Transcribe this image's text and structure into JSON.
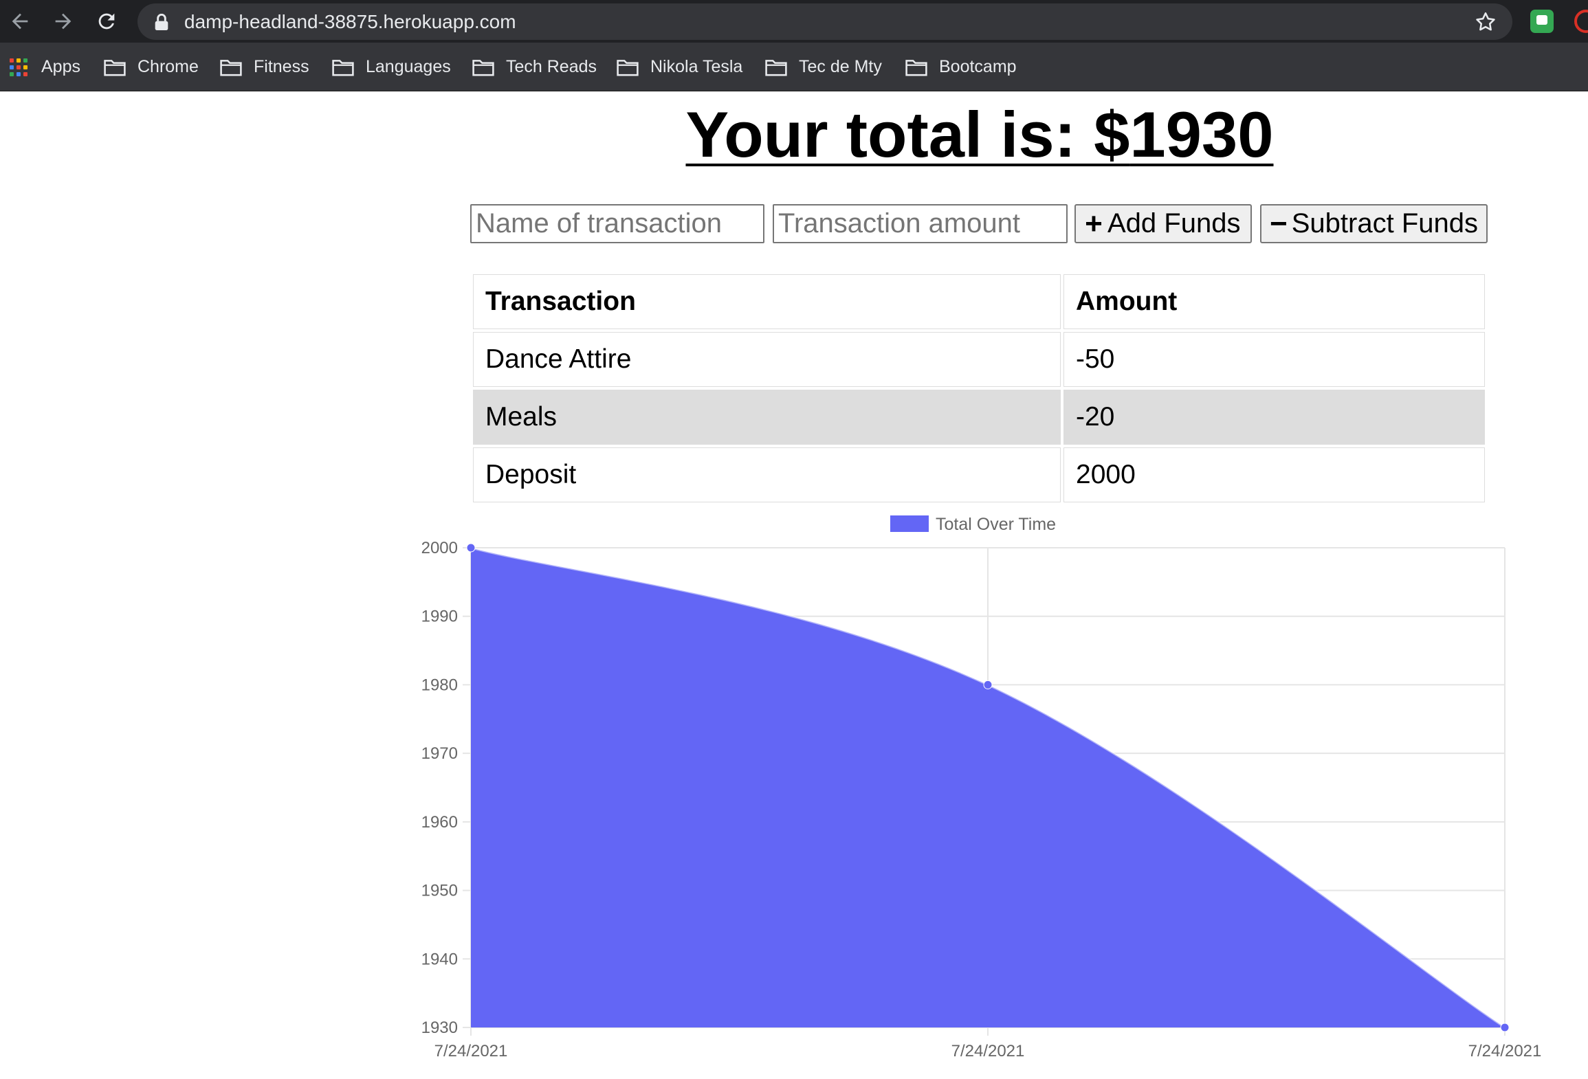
{
  "browser": {
    "url": "damp-headland-38875.herokuapp.com",
    "bookmarks": [
      {
        "label": "Apps",
        "icon": "apps-grid-icon"
      },
      {
        "label": "Chrome",
        "icon": "folder-icon"
      },
      {
        "label": "Fitness",
        "icon": "folder-icon"
      },
      {
        "label": "Languages",
        "icon": "folder-icon"
      },
      {
        "label": "Tech Reads",
        "icon": "folder-icon"
      },
      {
        "label": "Nikola Tesla",
        "icon": "folder-icon"
      },
      {
        "label": "Tec de Mty",
        "icon": "folder-icon"
      },
      {
        "label": "Bootcamp",
        "icon": "folder-icon"
      }
    ]
  },
  "page": {
    "total_prefix": "Your total is: $",
    "total_value": "1930"
  },
  "form": {
    "name_placeholder": "Name of transaction",
    "amount_placeholder": "Transaction amount",
    "add_label": "Add Funds",
    "subtract_label": "Subtract Funds"
  },
  "table": {
    "headers": [
      "Transaction",
      "Amount"
    ],
    "rows": [
      {
        "name": "Dance Attire",
        "amount": "-50"
      },
      {
        "name": "Meals",
        "amount": "-20"
      },
      {
        "name": "Deposit",
        "amount": "2000"
      }
    ]
  },
  "chart_data": {
    "type": "area",
    "legend": [
      "Total Over Time"
    ],
    "legend_position": "top",
    "x": [
      "7/24/2021",
      "7/24/2021",
      "7/24/2021"
    ],
    "series": [
      {
        "name": "Total Over Time",
        "values": [
          2000,
          1980,
          1930
        ],
        "color": "#6366f5"
      }
    ],
    "ylim": [
      1930,
      2000
    ],
    "yticks": [
      2000,
      1990,
      1980,
      1970,
      1960,
      1950,
      1940,
      1930
    ],
    "grid": true
  },
  "colors": {
    "chart_fill": "#6366f5",
    "alt_row": "#dddddd",
    "chrome_dark": "#202124"
  }
}
